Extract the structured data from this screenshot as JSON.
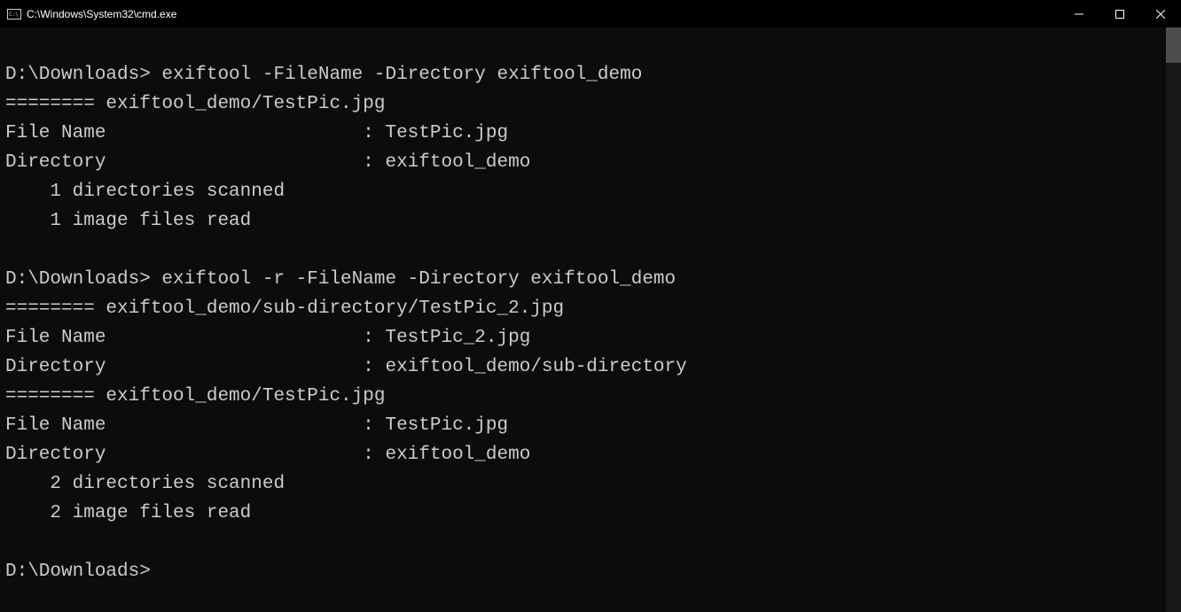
{
  "window": {
    "title": "C:\\Windows\\System32\\cmd.exe"
  },
  "terminal": {
    "lines": [
      "",
      "D:\\Downloads> exiftool -FileName -Directory exiftool_demo",
      "======== exiftool_demo/TestPic.jpg",
      "File Name                       : TestPic.jpg",
      "Directory                       : exiftool_demo",
      "    1 directories scanned",
      "    1 image files read",
      "",
      "D:\\Downloads> exiftool -r -FileName -Directory exiftool_demo",
      "======== exiftool_demo/sub-directory/TestPic_2.jpg",
      "File Name                       : TestPic_2.jpg",
      "Directory                       : exiftool_demo/sub-directory",
      "======== exiftool_demo/TestPic.jpg",
      "File Name                       : TestPic.jpg",
      "Directory                       : exiftool_demo",
      "    2 directories scanned",
      "    2 image files read",
      "",
      "D:\\Downloads>"
    ]
  }
}
